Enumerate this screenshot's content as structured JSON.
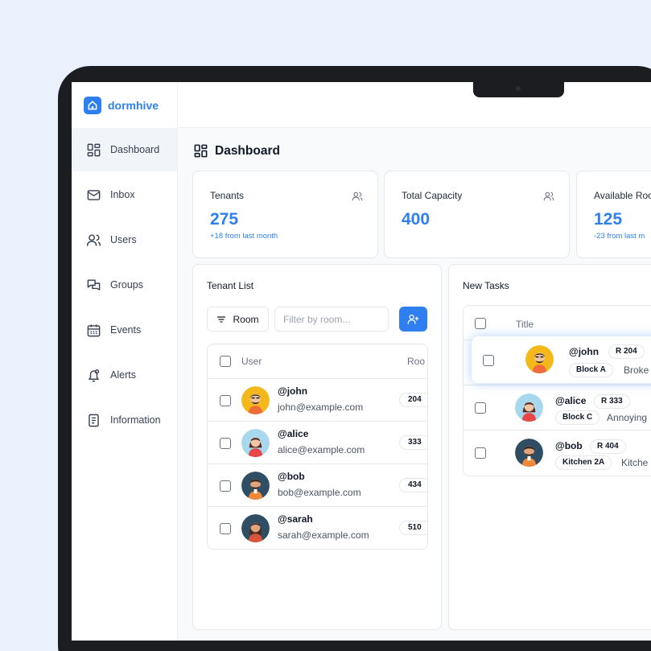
{
  "app": {
    "name": "dormhive"
  },
  "colors": {
    "accent": "#2f7ff0",
    "background": "#eaf1fc"
  },
  "sidebar": {
    "items": [
      {
        "label": "Dashboard",
        "icon": "dashboard-icon",
        "active": true
      },
      {
        "label": "Inbox",
        "icon": "mail-icon"
      },
      {
        "label": "Users",
        "icon": "users-icon"
      },
      {
        "label": "Groups",
        "icon": "chat-icon"
      },
      {
        "label": "Events",
        "icon": "calendar-icon"
      },
      {
        "label": "Alerts",
        "icon": "bell-icon"
      },
      {
        "label": "Information",
        "icon": "document-icon"
      }
    ]
  },
  "page": {
    "title": "Dashboard"
  },
  "stats": [
    {
      "title": "Tenants",
      "value": "275",
      "sub": "+18 from last month",
      "icon": "users-icon"
    },
    {
      "title": "Total Capacity",
      "value": "400",
      "sub": "",
      "icon": "users-icon"
    },
    {
      "title": "Available Roo",
      "value": "125",
      "sub": "-23 from last m",
      "icon": ""
    }
  ],
  "tenants": {
    "title": "Tenant List",
    "room_filter_label": "Room",
    "filter_placeholder": "Filter by room...",
    "columns": {
      "user": "User",
      "room": "Roo"
    },
    "rows": [
      {
        "handle": "@john",
        "email": "john@example.com",
        "room": "204"
      },
      {
        "handle": "@alice",
        "email": "alice@example.com",
        "room": "333"
      },
      {
        "handle": "@bob",
        "email": "bob@example.com",
        "room": "434"
      },
      {
        "handle": "@sarah",
        "email": "sarah@example.com",
        "room": "510"
      }
    ]
  },
  "tasks": {
    "title": "New Tasks",
    "columns": {
      "title": "Title"
    },
    "rows": [
      {
        "handle": "@john",
        "room": "R 204",
        "location": "Block A",
        "desc": "Broke"
      },
      {
        "handle": "@alice",
        "room": "R 333",
        "location": "Block C",
        "desc": "Annoying"
      },
      {
        "handle": "@bob",
        "room": "R 404",
        "location": "Kitchen 2A",
        "desc": "Kitche"
      }
    ]
  }
}
